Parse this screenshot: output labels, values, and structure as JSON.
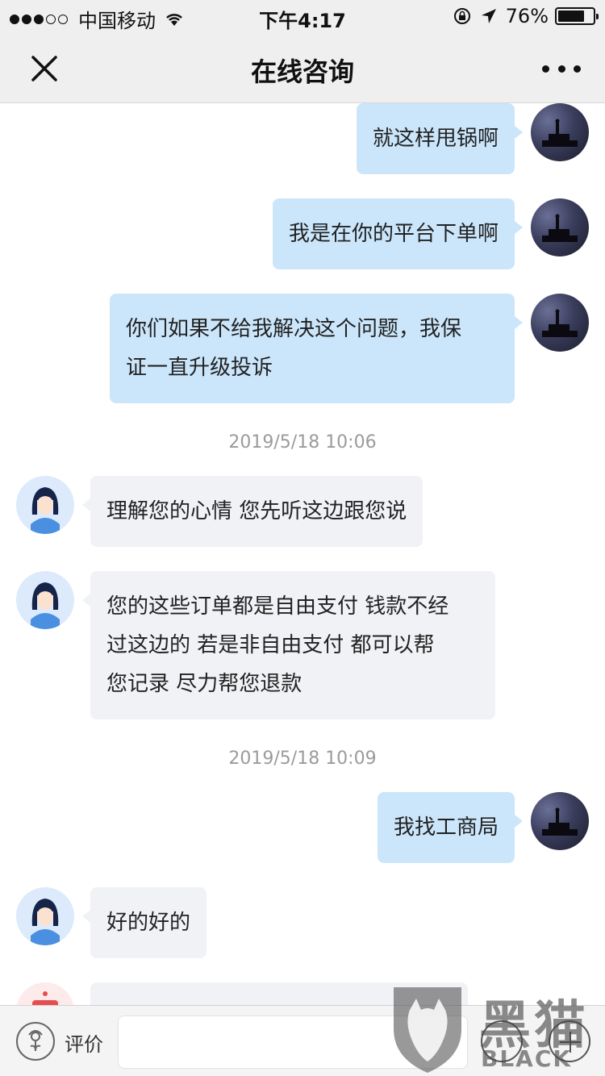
{
  "status_bar": {
    "carrier": "中国移动",
    "time": "下午4:17",
    "battery_percent": "76%",
    "battery_level": 0.76
  },
  "header": {
    "title": "在线咨询",
    "close_icon": "close-icon",
    "more_icon": "more-icon"
  },
  "messages": [
    {
      "side": "right",
      "text": "就这样甩锅啊"
    },
    {
      "side": "right",
      "text": "我是在你的平台下单啊"
    },
    {
      "side": "right",
      "lines": [
        "你们如果不给我解决这个问题，我保",
        "证一直升级投诉"
      ]
    },
    {
      "type": "time",
      "text": "2019/5/18 10:06"
    },
    {
      "side": "left",
      "text": "理解您的心情 您先听这边跟您说"
    },
    {
      "side": "left",
      "lines": [
        "您的这些订单都是自由支付 钱款不经",
        "过这边的 若是非自由支付 都可以帮",
        "您记录 尽力帮您退款"
      ]
    },
    {
      "type": "time",
      "text": "2019/5/18 10:09"
    },
    {
      "side": "right",
      "text": "我找工商局"
    },
    {
      "side": "left",
      "text": "好的好的"
    }
  ],
  "bottom_bar": {
    "rate_label": "评价",
    "input_placeholder": ""
  },
  "watermark": {
    "cn": "黑猫",
    "en": "BLACK CAT"
  },
  "colors": {
    "user_bubble": "#cbe6fb",
    "agent_bubble": "#f1f2f6",
    "header_bg": "#efefef"
  }
}
